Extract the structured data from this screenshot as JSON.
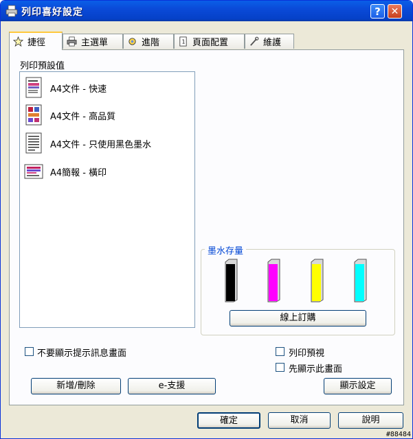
{
  "window": {
    "title": "列印喜好設定",
    "help_label": "?",
    "close_label": "✕"
  },
  "tabs": [
    {
      "label": "捷徑",
      "icon": "star-icon"
    },
    {
      "label": "主選單",
      "icon": "printer-icon"
    },
    {
      "label": "進階",
      "icon": "settings-icon"
    },
    {
      "label": "頁面配置",
      "icon": "page-icon"
    },
    {
      "label": "維護",
      "icon": "wrench-icon"
    }
  ],
  "presets": {
    "label": "列印預設值",
    "items": [
      {
        "label": "A4文件 - 快速"
      },
      {
        "label": "A4文件 - 高品質"
      },
      {
        "label": "A4文件 - 只使用黑色墨水"
      },
      {
        "label": "A4簡報 - 橫印"
      }
    ]
  },
  "ink": {
    "label": "墨水存量",
    "cartridges": [
      {
        "name": "black",
        "color": "#000000",
        "level": 1.0
      },
      {
        "name": "magenta",
        "color": "#ff00ff",
        "level": 1.0
      },
      {
        "name": "yellow",
        "color": "#ffff00",
        "level": 1.0
      },
      {
        "name": "cyan",
        "color": "#00ffff",
        "level": 1.0
      }
    ],
    "order_label": "線上訂購"
  },
  "options": {
    "hide_tips_label": "不要顯示提示訊息畫面",
    "print_preview_label": "列印預視",
    "show_first_label": "先顯示此畫面"
  },
  "buttons": {
    "add_delete": "新增/刪除",
    "support": "e-支援",
    "show_settings": "顯示設定",
    "ok": "確定",
    "cancel": "取消",
    "help": "說明"
  },
  "watermark": "#88484"
}
